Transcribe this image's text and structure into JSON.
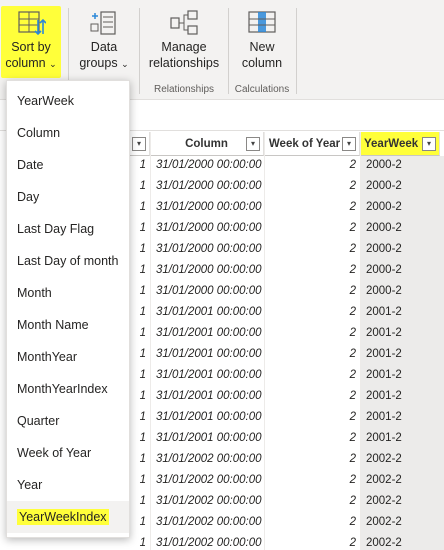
{
  "ribbon": {
    "sort_by_column": {
      "line1": "Sort by",
      "line2": "column"
    },
    "data_groups": {
      "line1": "Data",
      "line2": "groups"
    },
    "manage_relationships": {
      "line1": "Manage",
      "line2": "relationships"
    },
    "new_column": {
      "line1": "New",
      "line2": "column"
    },
    "groups": {
      "relationships": "Relationships",
      "calculations": "Calculations"
    },
    "chevron": "⌄"
  },
  "table": {
    "headers": [
      "Column",
      "Week of Year",
      "YearWeek"
    ],
    "dropdown_glyph": "▾",
    "rows": [
      [
        "1",
        "31/01/2000 00:00:00",
        "2",
        "2000-2"
      ],
      [
        "1",
        "31/01/2000 00:00:00",
        "2",
        "2000-2"
      ],
      [
        "1",
        "31/01/2000 00:00:00",
        "2",
        "2000-2"
      ],
      [
        "1",
        "31/01/2000 00:00:00",
        "2",
        "2000-2"
      ],
      [
        "1",
        "31/01/2000 00:00:00",
        "2",
        "2000-2"
      ],
      [
        "1",
        "31/01/2000 00:00:00",
        "2",
        "2000-2"
      ],
      [
        "1",
        "31/01/2000 00:00:00",
        "2",
        "2000-2"
      ],
      [
        "1",
        "31/01/2001 00:00:00",
        "2",
        "2001-2"
      ],
      [
        "1",
        "31/01/2001 00:00:00",
        "2",
        "2001-2"
      ],
      [
        "1",
        "31/01/2001 00:00:00",
        "2",
        "2001-2"
      ],
      [
        "1",
        "31/01/2001 00:00:00",
        "2",
        "2001-2"
      ],
      [
        "1",
        "31/01/2001 00:00:00",
        "2",
        "2001-2"
      ],
      [
        "1",
        "31/01/2001 00:00:00",
        "2",
        "2001-2"
      ],
      [
        "1",
        "31/01/2001 00:00:00",
        "2",
        "2001-2"
      ],
      [
        "1",
        "31/01/2002 00:00:00",
        "2",
        "2002-2"
      ],
      [
        "1",
        "31/01/2002 00:00:00",
        "2",
        "2002-2"
      ],
      [
        "1",
        "31/01/2002 00:00:00",
        "2",
        "2002-2"
      ],
      [
        "1",
        "31/01/2002 00:00:00",
        "2",
        "2002-2"
      ],
      [
        "1",
        "31/01/2002 00:00:00",
        "2",
        "2002-2"
      ]
    ]
  },
  "menu": {
    "items": [
      "YearWeek",
      "Column",
      "Date",
      "Day",
      "Last Day Flag",
      "Last Day of month",
      "Month",
      "Month Name",
      "MonthYear",
      "MonthYearIndex",
      "Quarter",
      "Week of Year",
      "Year",
      "YearWeekIndex"
    ],
    "highlighted": "YearWeekIndex"
  },
  "colors": {
    "highlight": "#ffff3a",
    "ribbon": "#f3f2f1"
  }
}
